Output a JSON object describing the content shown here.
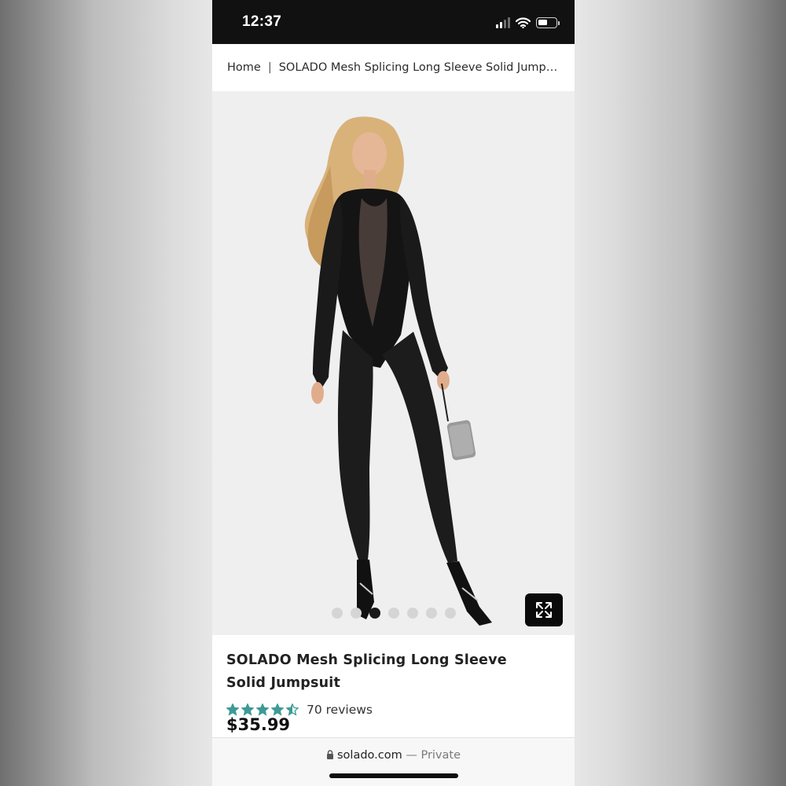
{
  "status_bar": {
    "time": "12:37"
  },
  "breadcrumb": {
    "home": "Home",
    "separator": "|",
    "current": "SOLADO Mesh Splicing Long Sleeve Solid Jumps..."
  },
  "gallery": {
    "image_count": 7,
    "active_index": 2,
    "expand_icon": "expand-arrows-icon"
  },
  "product": {
    "title": "SOLADO Mesh Splicing Long Sleeve Solid Jumpsuit",
    "rating": 4.5,
    "rating_max": 5,
    "reviews": "70 reviews",
    "price": "$35.99"
  },
  "browser": {
    "domain": "solado.com",
    "mode": "— Private"
  },
  "colors": {
    "star": "#3d9b96",
    "accent_dark": "#111111",
    "gallery_bg": "#efeff0"
  }
}
